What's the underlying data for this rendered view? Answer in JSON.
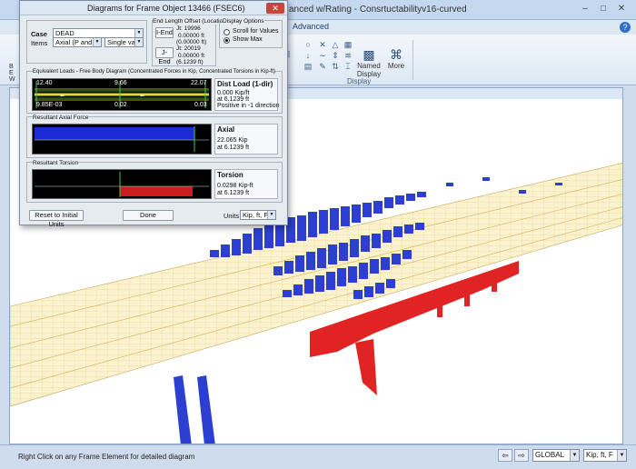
{
  "app": {
    "title": "anced w/Rating  -  Consrtuctabilityv16-curved",
    "tab_advanced": "Advanced",
    "ribbon": {
      "named_display": "Named Display",
      "more": "More",
      "group_display": "Display"
    },
    "left_strip_letters": [
      "B",
      "E",
      "W"
    ]
  },
  "dialog": {
    "title": "Diagrams for Frame Object 13466  (FSEC6)",
    "case_label": "Case",
    "case_value": "DEAD",
    "items_label": "Items",
    "items_value": "Axial (P and T)",
    "items_mode": "Single valued",
    "offset_group_title": "End Length Offset (Location)",
    "i_end": {
      "button": "I-End",
      "jt": "Jt:  19996",
      "v1": "0.00000 ft",
      "v2": "(0.00000 ft)"
    },
    "j_end": {
      "button": "J-End",
      "jt": "Jt:  20019",
      "v1": "0.00000 ft",
      "v2": "(6.1239 ft)"
    },
    "display_options_title": "Display Options",
    "scroll_for_values": "Scroll for Values",
    "show_max": "Show Max",
    "selected_option": "show_max",
    "fbd_title": "Equivalent Loads - Free Body Diagram  (Concentrated Forces in Kip, Concentrated Torsions in Kip-ft)",
    "fbd_values": {
      "top_left": "12.40",
      "top_mid": "9.66",
      "top_right": "22.07",
      "bot_left": "9.85E-03",
      "bot_mid": "0.02",
      "bot_right": "0.03"
    },
    "dist_load": {
      "heading": "Dist Load (1-dir)",
      "value": "0.000 Kip/ft",
      "location": "at 6.1239 ft",
      "note": "Positive in -1 direction"
    },
    "axial_title": "Resultant Axial Force",
    "axial": {
      "heading": "Axial",
      "value": "22.065 Kip",
      "location": "at 6.1239 ft"
    },
    "torsion_title": "Resultant Torsion",
    "torsion": {
      "heading": "Torsion",
      "value": "0.0298 Kip-ft",
      "location": "at 6.1239 ft"
    },
    "reset_button": "Reset to Initial Units",
    "done_button": "Done",
    "units_label": "Units",
    "units_value": "Kip, ft, F"
  },
  "status": {
    "text": "Right Click on any Frame Element for detailed diagram",
    "coord_system": "GLOBAL",
    "units": "Kip, ft, F"
  },
  "colors": {
    "axial": "#1a2bd6",
    "torsion": "#c81e1e",
    "deck": "#fbf3cf",
    "blue_loads": "#2c3fd0",
    "red_loads": "#e02424"
  }
}
